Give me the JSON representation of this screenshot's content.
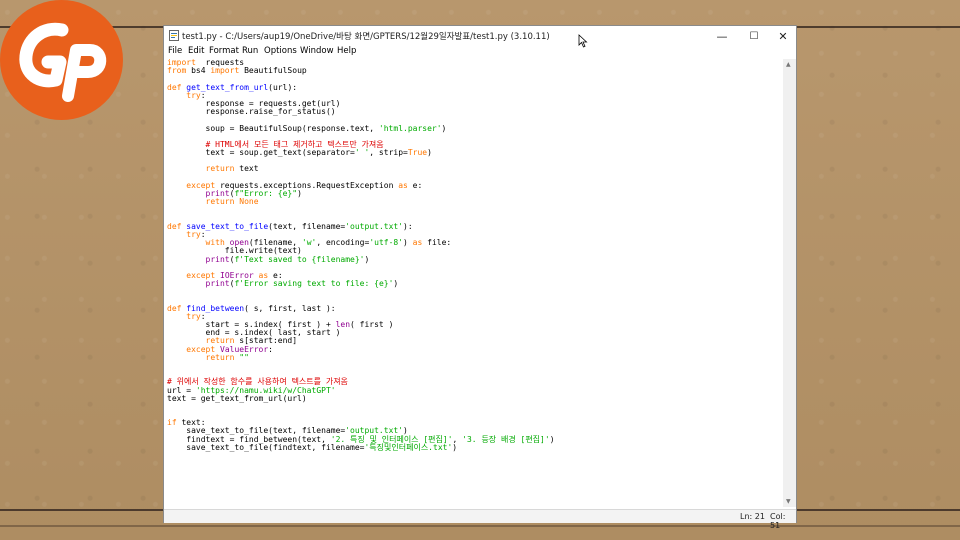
{
  "window": {
    "title": "test1.py - C:/Users/aup19/OneDrive/바탕 화면/GPTERS/12월29일자발표/test1.py (3.10.11)",
    "controls": {
      "minimize": "—",
      "maximize": "☐",
      "close": "✕"
    }
  },
  "menu": [
    "File",
    "Edit",
    "Format",
    "Run",
    "Options",
    "Window",
    "Help"
  ],
  "code": [
    [
      [
        "kw",
        "import"
      ],
      [
        "",
        "  requests"
      ]
    ],
    [
      [
        "kw",
        "from"
      ],
      [
        "",
        " bs4 "
      ],
      [
        "kw",
        "import"
      ],
      [
        "",
        " BeautifulSoup"
      ]
    ],
    [],
    [
      [
        "kw",
        "def"
      ],
      [
        "",
        " "
      ],
      [
        "df",
        "get_text_from_url"
      ],
      [
        "",
        "(url):"
      ]
    ],
    [
      [
        "",
        "    "
      ],
      [
        "kw",
        "try"
      ],
      [
        "",
        ":"
      ]
    ],
    [
      [
        "",
        "        response = requests.get(url)"
      ]
    ],
    [
      [
        "",
        "        response.raise_for_status()"
      ]
    ],
    [],
    [
      [
        "",
        "        soup = BeautifulSoup(response.text, "
      ],
      [
        "st",
        "'html.parser'"
      ],
      [
        "",
        ")"
      ]
    ],
    [],
    [
      [
        "",
        "        "
      ],
      [
        "cm",
        "# HTML에서 모든 태그 제거하고 텍스트만 가져옴"
      ]
    ],
    [
      [
        "",
        "        text = soup.get_text(separator="
      ],
      [
        "st",
        "' '"
      ],
      [
        "",
        ", strip="
      ],
      [
        "kw",
        "True"
      ],
      [
        "",
        ")"
      ]
    ],
    [],
    [
      [
        "",
        "        "
      ],
      [
        "kw",
        "return"
      ],
      [
        "",
        " text"
      ]
    ],
    [],
    [
      [
        "",
        "    "
      ],
      [
        "kw",
        "except"
      ],
      [
        "",
        " requests.exceptions.RequestException "
      ],
      [
        "kw",
        "as"
      ],
      [
        "",
        " e:"
      ]
    ],
    [
      [
        "",
        "        "
      ],
      [
        "bi",
        "print"
      ],
      [
        "",
        "("
      ],
      [
        "st",
        "f\"Error: {e}\""
      ],
      [
        "",
        ")"
      ]
    ],
    [
      [
        "",
        "        "
      ],
      [
        "kw",
        "return"
      ],
      [
        "",
        " "
      ],
      [
        "kw",
        "None"
      ]
    ],
    [],
    [],
    [
      [
        "kw",
        "def"
      ],
      [
        "",
        " "
      ],
      [
        "df",
        "save_text_to_file"
      ],
      [
        "",
        "(text, filename="
      ],
      [
        "st",
        "'output.txt'"
      ],
      [
        "",
        "):"
      ]
    ],
    [
      [
        "",
        "    "
      ],
      [
        "kw",
        "try"
      ],
      [
        "",
        ":"
      ]
    ],
    [
      [
        "",
        "        "
      ],
      [
        "kw",
        "with"
      ],
      [
        "",
        " "
      ],
      [
        "bi",
        "open"
      ],
      [
        "",
        "(filename, "
      ],
      [
        "st",
        "'w'"
      ],
      [
        "",
        ", encoding="
      ],
      [
        "st",
        "'utf-8'"
      ],
      [
        "",
        ") "
      ],
      [
        "kw",
        "as"
      ],
      [
        "",
        " file:"
      ]
    ],
    [
      [
        "",
        "            file.write(text)"
      ]
    ],
    [
      [
        "",
        "        "
      ],
      [
        "bi",
        "print"
      ],
      [
        "",
        "("
      ],
      [
        "st",
        "f'Text saved to {filename}'"
      ],
      [
        "",
        ")"
      ]
    ],
    [],
    [
      [
        "",
        "    "
      ],
      [
        "kw",
        "except"
      ],
      [
        "",
        " "
      ],
      [
        "bi",
        "IOError"
      ],
      [
        "",
        " "
      ],
      [
        "kw",
        "as"
      ],
      [
        "",
        " e:"
      ]
    ],
    [
      [
        "",
        "        "
      ],
      [
        "bi",
        "print"
      ],
      [
        "",
        "("
      ],
      [
        "st",
        "f'Error saving text to file: {e}'"
      ],
      [
        "",
        ")"
      ]
    ],
    [],
    [],
    [
      [
        "kw",
        "def"
      ],
      [
        "",
        " "
      ],
      [
        "df",
        "find_between"
      ],
      [
        "",
        "( s, first, last ):"
      ]
    ],
    [
      [
        "",
        "    "
      ],
      [
        "kw",
        "try"
      ],
      [
        "",
        ":"
      ]
    ],
    [
      [
        "",
        "        start = s.index( first ) + "
      ],
      [
        "bi",
        "len"
      ],
      [
        "",
        "( first )"
      ]
    ],
    [
      [
        "",
        "        end = s.index( last, start )"
      ]
    ],
    [
      [
        "",
        "        "
      ],
      [
        "kw",
        "return"
      ],
      [
        "",
        " s[start:end]"
      ]
    ],
    [
      [
        "",
        "    "
      ],
      [
        "kw",
        "except"
      ],
      [
        "",
        " "
      ],
      [
        "bi",
        "ValueError"
      ],
      [
        "",
        ":"
      ]
    ],
    [
      [
        "",
        "        "
      ],
      [
        "kw",
        "return"
      ],
      [
        "",
        " "
      ],
      [
        "st",
        "\"\""
      ]
    ],
    [],
    [],
    [
      [
        "cm",
        "# 위에서 작성한 함수를 사용하여 텍스트를 가져옴"
      ]
    ],
    [
      [
        "",
        "url = "
      ],
      [
        "st",
        "'https://namu.wiki/w/ChatGPT'"
      ]
    ],
    [
      [
        "",
        "text = get_text_from_url(url)"
      ]
    ],
    [],
    [],
    [
      [
        "kw",
        "if"
      ],
      [
        "",
        " text:"
      ]
    ],
    [
      [
        "",
        "    save_text_to_file(text, filename="
      ],
      [
        "st",
        "'output.txt'"
      ],
      [
        "",
        ")"
      ]
    ],
    [
      [
        "",
        "    findtext = find_between(text, "
      ],
      [
        "st",
        "'2. 특징 및 인터페이스 [편집]'"
      ],
      [
        "",
        ", "
      ],
      [
        "st",
        "'3. 등장 배경 [편집]'"
      ],
      [
        "",
        ")"
      ]
    ],
    [
      [
        "",
        "    save_text_to_file(findtext, filename="
      ],
      [
        "st",
        "'특징및인터페이스.txt'"
      ],
      [
        "",
        ")"
      ]
    ]
  ],
  "status": {
    "line": "Ln: 21",
    "col": "Col: 51"
  },
  "colors": {
    "keyword": "#ff7700",
    "builtin": "#900090",
    "string": "#00aa00",
    "comment": "#dd0000",
    "def_name": "#0000ff",
    "logo": "#e8601c"
  }
}
